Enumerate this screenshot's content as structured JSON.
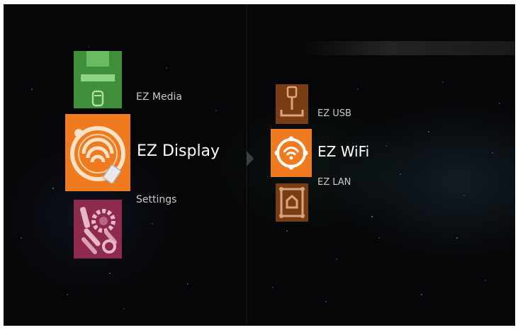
{
  "main_menu": {
    "items": [
      {
        "label": "EZ Media",
        "icon": "media-icon",
        "color": "#3f8f3a"
      },
      {
        "label": "EZ Display",
        "icon": "wifi-display-icon",
        "color": "#f07a1e"
      },
      {
        "label": "Settings",
        "icon": "settings-tools-icon",
        "color": "#8e2a4e"
      }
    ]
  },
  "sub_menu": {
    "items": [
      {
        "label": "EZ USB",
        "icon": "usb-icon",
        "color": "#7a3c12"
      },
      {
        "label": "EZ WiFi",
        "icon": "wifi-icon",
        "color": "#f07a1e"
      },
      {
        "label": "EZ LAN",
        "icon": "lan-icon",
        "color": "#7a3c12"
      }
    ]
  },
  "colors": {
    "background": "#050607",
    "selected_tile": "#f07a1e",
    "text": "#ffffff"
  }
}
